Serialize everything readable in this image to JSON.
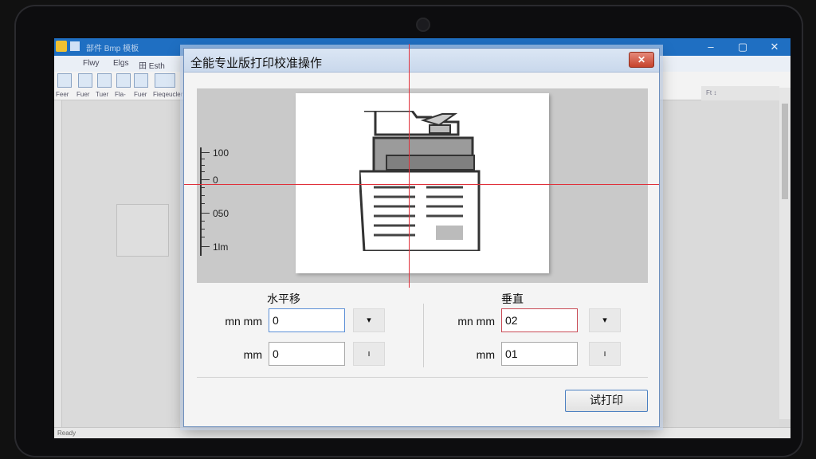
{
  "app": {
    "title": "部件 Bmp 模板",
    "minimize_glyph": "–",
    "maximize_glyph": "▢",
    "close_glyph": "✕",
    "tabs": [
      "Flwy",
      "Elgs",
      "田 Esth"
    ],
    "ribbon_labels": [
      "Feer",
      "Fuer",
      "Tuer",
      "Fla-",
      "Fuer",
      "Fieqeucler"
    ],
    "right_pane_text": "Ft ↕",
    "status_text": "Ready"
  },
  "dialog": {
    "title": "全能专业版打印校准操作",
    "close_glyph": "✕",
    "ruler": {
      "labels": [
        "100",
        "0",
        "050",
        "1lm"
      ]
    },
    "horizontal": {
      "label": "水平移",
      "rows": [
        {
          "unit": "mn mm",
          "value": "0",
          "spin_glyph": "▾"
        },
        {
          "unit": "mm",
          "value": "0",
          "spin_glyph": "ı"
        }
      ]
    },
    "vertical": {
      "label": "垂直",
      "rows": [
        {
          "unit": "mn mm",
          "value": "02",
          "spin_glyph": "▾"
        },
        {
          "unit": "mm",
          "value": "01",
          "spin_glyph": "ı"
        }
      ]
    },
    "print_button": "试打印"
  },
  "colors": {
    "crosshair": "#e0303a",
    "titlebar": "#1f6fc2",
    "button_border": "#4a7fc1"
  }
}
